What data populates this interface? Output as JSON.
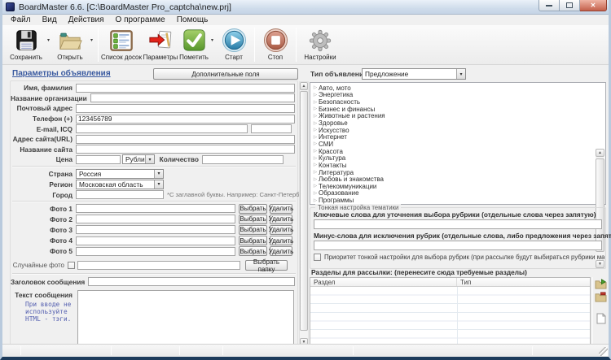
{
  "window": {
    "title": "BoardMaster 6.6. [C:\\BoardMaster Pro_captcha\\new.prj]"
  },
  "icons": {
    "dropdown": "▾",
    "tree_collapsed": "▷",
    "scroll_up": "▲",
    "scroll_down": "▼",
    "close": "✕"
  },
  "menu": [
    "Файл",
    "Вид",
    "Действия",
    "О программе",
    "Помощь"
  ],
  "toolbar": {
    "save": "Сохранить",
    "open": "Открыть",
    "board_list": "Список досок",
    "parameters": "Параметры",
    "mark": "Пометить",
    "start": "Старт",
    "stop": "Стоп",
    "settings": "Настройки"
  },
  "left": {
    "title": "Параметры объявления",
    "extra_fields_button": "Дополнительные поля",
    "labels": {
      "name": "Имя, фамилия",
      "organization": "Название организации",
      "postal_address": "Почтовый адрес",
      "phone": "Телефон (+)",
      "email": "E-mail, ICQ",
      "site_url": "Адрес сайта(URL)",
      "site_name": "Название сайта",
      "price": "Цена",
      "quantity": "Количество",
      "country": "Страна",
      "region": "Регион",
      "city": "Город",
      "random_photo": "Случайные фото",
      "subject": "Заголовок сообщения",
      "message": "Текст сообщения"
    },
    "values": {
      "phone": "123456789",
      "currency": "Рубли",
      "country": "Россия",
      "region": "Московская область"
    },
    "hints": {
      "city": "*С заглавной буквы. Например: Санкт-Петербург",
      "message": "При вводе не используйте HTML - тэги."
    },
    "photos": [
      "Фото 1",
      "Фото 2",
      "Фото 3",
      "Фото 4",
      "Фото 5"
    ],
    "buttons": {
      "choose": "Выбрать",
      "delete": "Удалить",
      "choose_folder": "Выбрать папку"
    }
  },
  "right": {
    "type_label": "Тип объявлений:",
    "type_value": "Предложение",
    "categories": [
      "Авто, мото",
      "Энергетика",
      "Безопасность",
      "Бизнес и финансы",
      "Животные и растения",
      "Здоровье",
      "Искусство",
      "Интернет",
      "СМИ",
      "Красота",
      "Культура",
      "Контакты",
      "Литература",
      "Любовь и знакомства",
      "Телекоммуникации",
      "Образование",
      "Программы"
    ],
    "fine_tuning": {
      "legend": "Тонкая настройка тематики",
      "keywords_label": "Ключевые слова для уточнения выбора рубрики (отдельные слова через запятую)",
      "minus_words_label": "Минус-слова для исключения рубрик (отдельные слова, либо предложения через запятую)",
      "priority_checkbox": "Приоритет тонкой настройки для выбора рубрик (при рассылке будут выбираться рубрики максимально соответствующие"
    },
    "sections": {
      "label": "Разделы для рассылки: (перенесите сюда требуемые разделы)",
      "columns": [
        "Раздел",
        "Тип"
      ]
    }
  }
}
